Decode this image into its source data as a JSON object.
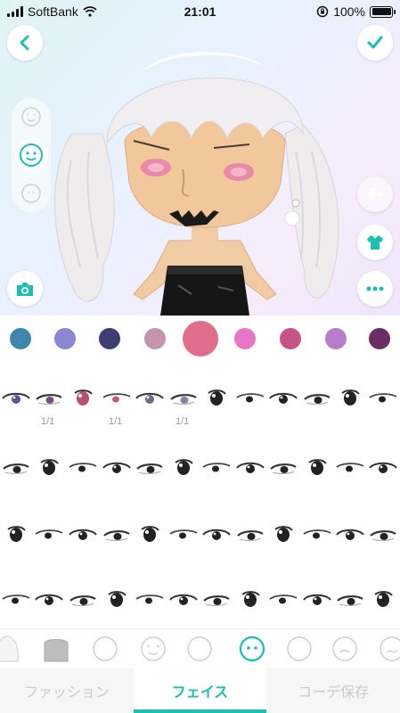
{
  "status_bar": {
    "carrier": "SoftBank",
    "time": "21:01",
    "battery_percent": "100%",
    "battery_level": 1.0
  },
  "preview": {
    "back_icon": "chevron-left-icon",
    "confirm_icon": "checkmark-icon",
    "camera_icon": "camera-icon",
    "arrow_icon": "arrow-left-icon",
    "outfit_icon": "shirt-icon",
    "more_icon": "more-dots-icon",
    "face_options": [
      "face-happy-icon",
      "face-neutral-icon",
      "face-plain-icon"
    ],
    "accent_color": "#1dbfb0"
  },
  "palette": {
    "colors": [
      "#3f86ac",
      "#8a86d2",
      "#3e3e72",
      "#c294ad",
      "#e06d8c",
      "#e776c4",
      "#c85387",
      "#b77ccb",
      "#6b2f66"
    ],
    "selected_index": 4
  },
  "eyes": {
    "counts": [
      "1/1",
      "1/1",
      "1/1"
    ],
    "rows": 4,
    "per_row": 12
  },
  "face_shapes": {
    "selected_index": 5
  },
  "tabs": {
    "fashion": "ファッション",
    "face": "フェイス",
    "save_coord": "コーデ保存"
  }
}
